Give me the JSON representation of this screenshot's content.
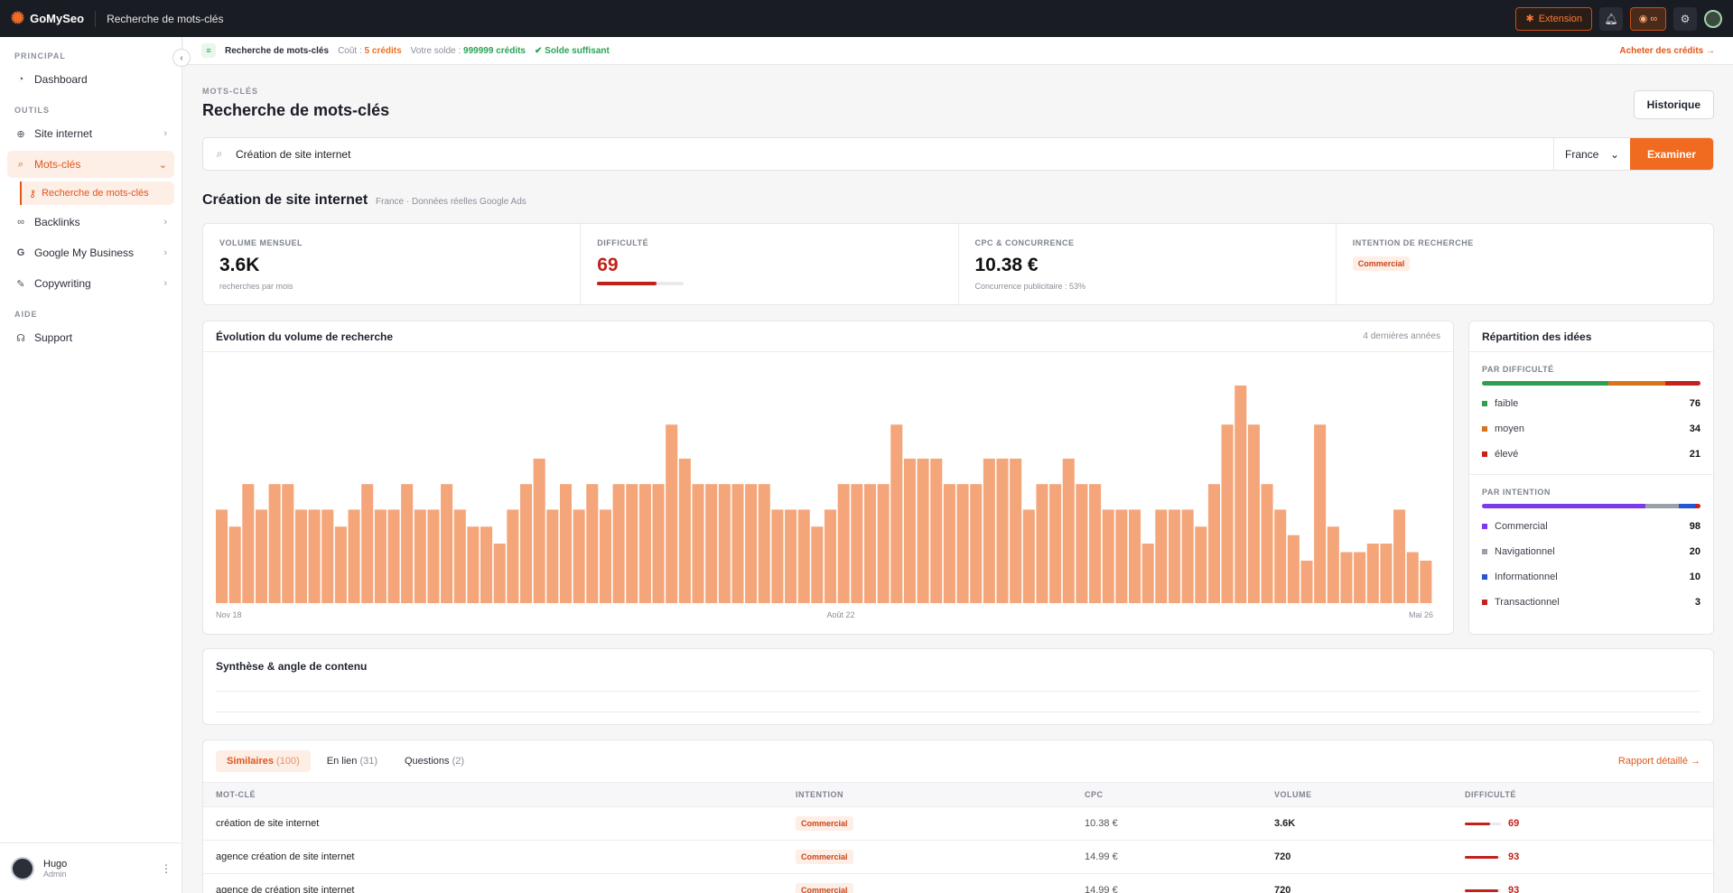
{
  "topbar": {
    "brand": "GoMySeo",
    "page_title": "Recherche de mots-clés",
    "extension_label": "Extension",
    "credits_label": "∞"
  },
  "sidebar": {
    "sections": {
      "principal": "PRINCIPAL",
      "outils": "OUTILS",
      "aide": "AIDE"
    },
    "items": {
      "dashboard": "Dashboard",
      "site": "Site internet",
      "motscles": "Mots-clés",
      "recherche": "Recherche de mots-clés",
      "backlinks": "Backlinks",
      "gmb": "Google My Business",
      "copywriting": "Copywriting",
      "support": "Support"
    },
    "user": {
      "name": "Hugo",
      "role": "Admin"
    }
  },
  "creditbar": {
    "title": "Recherche de mots-clés",
    "cost_label": "Coût :",
    "cost_value": "5 crédits",
    "balance_label": "Votre solde :",
    "balance_value": "999999 crédits",
    "status": "Solde suffisant",
    "buy": "Acheter des crédits →"
  },
  "header": {
    "eyebrow": "MOTS-CLÉS",
    "title": "Recherche de mots-clés",
    "history": "Historique"
  },
  "search": {
    "value": "Création de site internet",
    "country": "France",
    "submit": "Examiner"
  },
  "keyword": {
    "title": "Création de site internet",
    "subtitle": "France · Données réelles Google Ads"
  },
  "stats": {
    "volume": {
      "label": "VOLUME MENSUEL",
      "value": "3.6K",
      "sub": "recherches par mois"
    },
    "difficulty": {
      "label": "DIFFICULTÉ",
      "value": "69",
      "level": 0.69
    },
    "cpc": {
      "label": "CPC & CONCURRENCE",
      "value": "10.38 €",
      "sub": "Concurrence publicitaire : 53%"
    },
    "intent": {
      "label": "INTENTION DE RECHERCHE",
      "value": "Commercial"
    }
  },
  "chart": {
    "title": "Évolution du volume de recherche",
    "range": "4 dernières années"
  },
  "chart_data": {
    "type": "bar",
    "title": "Évolution du volume de recherche",
    "x_ticks": [
      "Nov 18",
      "Août 22",
      "Mai 26"
    ],
    "ylim": [
      0,
      12
    ],
    "values": [
      5.5,
      4.5,
      7,
      5.5,
      7,
      7,
      5.5,
      5.5,
      5.5,
      4.5,
      5.5,
      7,
      5.5,
      5.5,
      7,
      5.5,
      5.5,
      7,
      5.5,
      4.5,
      4.5,
      3.5,
      5.5,
      7,
      8.5,
      5.5,
      7,
      5.5,
      7,
      5.5,
      7,
      7,
      7,
      7,
      10.5,
      8.5,
      7,
      7,
      7,
      7,
      7,
      7,
      5.5,
      5.5,
      5.5,
      4.5,
      5.5,
      7,
      7,
      7,
      7,
      10.5,
      8.5,
      8.5,
      8.5,
      7,
      7,
      7,
      8.5,
      8.5,
      8.5,
      5.5,
      7,
      7,
      8.5,
      7,
      7,
      5.5,
      5.5,
      5.5,
      3.5,
      5.5,
      5.5,
      5.5,
      4.5,
      7,
      10.5,
      12.8,
      10.5,
      7,
      5.5,
      4,
      2.5,
      10.5,
      4.5,
      3,
      3,
      3.5,
      3.5,
      5.5,
      3,
      2.5
    ]
  },
  "ideas": {
    "title": "Répartition des idées",
    "difficulty_label": "PAR DIFFICULTÉ",
    "difficulty": [
      {
        "name": "faible",
        "count": "76",
        "color": "#2e9e4f"
      },
      {
        "name": "moyen",
        "count": "34",
        "color": "#d8731c"
      },
      {
        "name": "élevé",
        "count": "21",
        "color": "#c4221c"
      }
    ],
    "intent_label": "PAR INTENTION",
    "intent": [
      {
        "name": "Commercial",
        "count": "98",
        "color": "#7c3aed"
      },
      {
        "name": "Navigationnel",
        "count": "20",
        "color": "#9aa0a8"
      },
      {
        "name": "Informationnel",
        "count": "10",
        "color": "#2456d6"
      },
      {
        "name": "Transactionnel",
        "count": "3",
        "color": "#c4221c"
      }
    ]
  },
  "synthesis": {
    "title": "Synthèse & angle de contenu"
  },
  "table": {
    "tabs": [
      {
        "label": "Similaires",
        "count": "(100)"
      },
      {
        "label": "En lien",
        "count": "(31)"
      },
      {
        "label": "Questions",
        "count": "(2)"
      }
    ],
    "report": "Rapport détaillé →",
    "headers": [
      "MOT-CLÉ",
      "INTENTION",
      "CPC",
      "VOLUME",
      "DIFFICULTÉ"
    ],
    "rows": [
      {
        "kw": "création de site internet",
        "intent": "Commercial",
        "cpc": "10.38 €",
        "vol": "3.6K",
        "diff": "69",
        "level": 0.69
      },
      {
        "kw": "agence création de site internet",
        "intent": "Commercial",
        "cpc": "14.99 €",
        "vol": "720",
        "diff": "93",
        "level": 0.93
      },
      {
        "kw": "agence de création site internet",
        "intent": "Commercial",
        "cpc": "14.99 €",
        "vol": "720",
        "diff": "93",
        "level": 0.93
      }
    ]
  }
}
